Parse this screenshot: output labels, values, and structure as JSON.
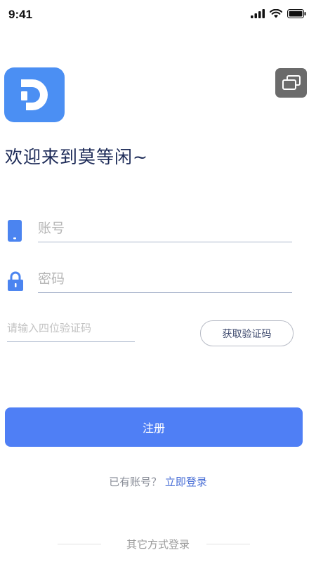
{
  "status_bar": {
    "time": "9:41"
  },
  "header": {
    "welcome_text": "欢迎来到莫等闲~"
  },
  "form": {
    "account_placeholder": "账号",
    "password_placeholder": "密码",
    "code_placeholder": "请输入四位验证码",
    "get_code_label": "获取验证码",
    "register_label": "注册"
  },
  "footer": {
    "have_account_text": "已有账号？",
    "login_link_text": "立即登录",
    "other_login_text": "其它方式登录"
  },
  "colors": {
    "accent": "#4f7ff5",
    "logo_bg": "#4b8ff3",
    "title_text": "#1c2a57",
    "link": "#4a6fd6"
  }
}
